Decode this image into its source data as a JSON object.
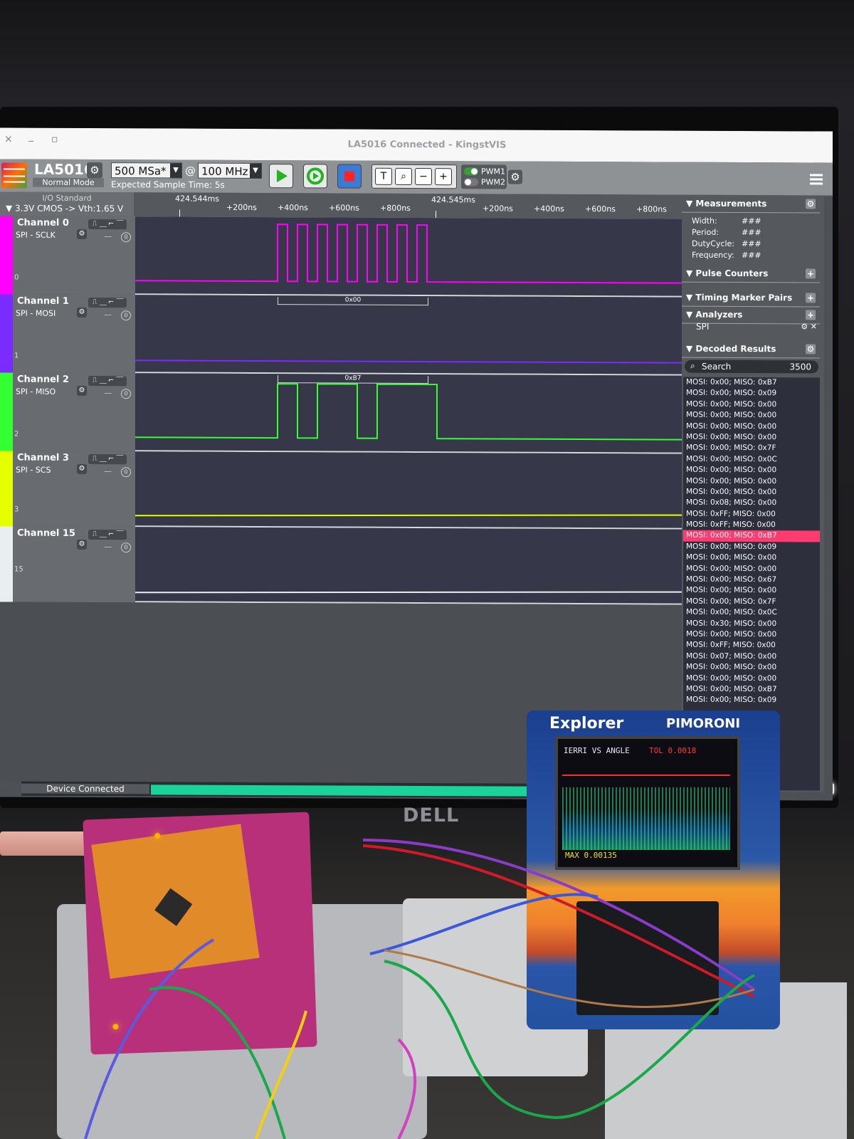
{
  "window": {
    "title": "LA5016 Connected - KingstVIS",
    "close": "×",
    "minimize": "_",
    "maximize": "▫"
  },
  "toolbar": {
    "device_name": "LA5016",
    "device_mode": "Normal Mode",
    "sample_rate": "500 MSa*",
    "at_sign": "@",
    "frequency": "100 MHz",
    "expected_sample_time": "Expected Sample Time: 5s",
    "pwm1": "PWM1",
    "pwm2": "PWM2",
    "tool_text": "T",
    "tool_zoom_fit": "⌕",
    "tool_zoom_out": "−",
    "tool_zoom_in": "+"
  },
  "io": {
    "title": "I/O Standard",
    "vth": "▼ 3.3V CMOS  -> Vth:1.65 V"
  },
  "ruler": {
    "ticks": [
      "424.544ms",
      "+200ns",
      "+400ns",
      "+600ns",
      "+800ns",
      "424.545ms",
      "+200ns",
      "+400ns",
      "+600ns",
      "+800ns"
    ]
  },
  "channels": [
    {
      "name": "Channel 0",
      "label": "SPI - SCLK",
      "index": "0",
      "color": "#ff00ff",
      "decode": "",
      "decode_color": ""
    },
    {
      "name": "Channel 1",
      "label": "SPI - MOSI",
      "index": "1",
      "color": "#7a2cff",
      "decode": "0x00",
      "decode_color": "#7a2cff"
    },
    {
      "name": "Channel 2",
      "label": "SPI - MISO",
      "index": "2",
      "color": "#33ff33",
      "decode": "0xB7",
      "decode_color": "#33ff33"
    },
    {
      "name": "Channel 3",
      "label": "SPI - SCS",
      "index": "3",
      "color": "#e6ff00",
      "decode": "",
      "decode_color": ""
    },
    {
      "name": "Channel 15",
      "label": "",
      "index": "15",
      "color": "#e9eef0",
      "decode": "",
      "decode_color": ""
    }
  ],
  "right_panel": {
    "measurements": "▼ Measurements",
    "width_label": "Width:",
    "period_label": "Period:",
    "duty_label": "DutyCycle:",
    "freq_label": "Frequency:",
    "placeholder_value": "###",
    "pulse_counters": "▼ Pulse Counters",
    "timing_marker_pairs": "▼ Timing Marker Pairs",
    "analyzers": "▼ Analyzers",
    "analyzer_item": "SPI",
    "decoded_results": "▼ Decoded Results",
    "search": "Search",
    "result_count": "3500",
    "plus": "+"
  },
  "decoded_results": [
    "MOSI: 0x00;  MISO: 0xB7",
    "MOSI: 0x00;  MISO: 0x09",
    "MOSI: 0x00;  MISO: 0x00",
    "MOSI: 0x00;  MISO: 0x00",
    "MOSI: 0x00;  MISO: 0x00",
    "MOSI: 0x00;  MISO: 0x00",
    "MOSI: 0x00;  MISO: 0x7F",
    "MOSI: 0x00;  MISO: 0x0C",
    "MOSI: 0x00;  MISO: 0x00",
    "MOSI: 0x00;  MISO: 0x00",
    "MOSI: 0x00;  MISO: 0x00",
    "MOSI: 0x08;  MISO: 0x00",
    "MOSI: 0xFF;  MISO: 0x00",
    "MOSI: 0xFF;  MISO: 0x00",
    "MOSI: 0x00;  MISO: 0xB7",
    "MOSI: 0x00;  MISO: 0x09",
    "MOSI: 0x00;  MISO: 0x00",
    "MOSI: 0x00;  MISO: 0x00",
    "MOSI: 0x00;  MISO: 0x67",
    "MOSI: 0x00;  MISO: 0x00",
    "MOSI: 0x00;  MISO: 0x7F",
    "MOSI: 0x00;  MISO: 0x0C",
    "MOSI: 0x30;  MISO: 0x00",
    "MOSI: 0x00;  MISO: 0x00",
    "MOSI: 0xFF;  MISO: 0x00",
    "MOSI: 0x07;  MISO: 0x00",
    "MOSI: 0x00;  MISO: 0x00",
    "MOSI: 0x00;  MISO: 0x00",
    "MOSI: 0x00;  MISO: 0xB7",
    "MOSI: 0x00;  MISO: 0x09"
  ],
  "selected_result_index": 14,
  "status": {
    "text": "Device Connected"
  },
  "monitor": {
    "brand": "DELL"
  },
  "explorer": {
    "brand": "Explorer",
    "maker": "PIMORONI",
    "screen_title": "IERRI VS ANGLE",
    "tol": "TOL 0.0018",
    "max": "MAX 0.00135"
  },
  "colors": {
    "accent_progress": "#19d39a",
    "selected_row": "#ff3b6f"
  }
}
